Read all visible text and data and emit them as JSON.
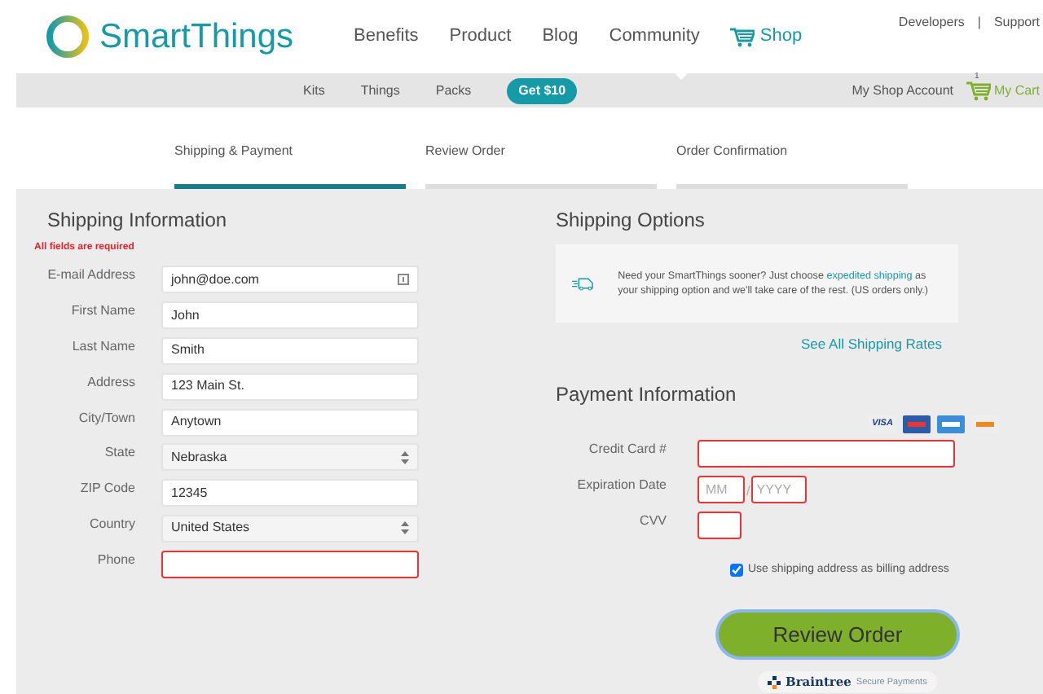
{
  "header": {
    "brand": "SmartThings",
    "nav": [
      {
        "label": "Benefits",
        "selected": false,
        "kind": "text"
      },
      {
        "label": "Product",
        "selected": false,
        "kind": "text"
      },
      {
        "label": "Blog",
        "selected": false,
        "kind": "text"
      },
      {
        "label": "Community",
        "selected": false,
        "kind": "text"
      },
      {
        "label": "Shop",
        "selected": true,
        "kind": "shop"
      }
    ],
    "utility_links": [
      "Developers",
      "|",
      "Support"
    ]
  },
  "subnav": {
    "items": [
      "Kits",
      "Things",
      "Packs"
    ],
    "promo": "Get $10",
    "account": "My Shop Account",
    "cart": {
      "label": "My Cart",
      "count": "1"
    }
  },
  "steps": [
    {
      "label": "Shipping & Payment",
      "selected": true
    },
    {
      "label": "Review Order",
      "selected": false
    },
    {
      "label": "Order Confirmation",
      "selected": false
    }
  ],
  "shipping_information": {
    "title": "Shipping Information",
    "required_note": "All fields are required",
    "fields": [
      {
        "label": "E-mail Address",
        "kind": "text",
        "value": "john@doe.com",
        "invalid": false,
        "autofill": true
      },
      {
        "label": "First Name",
        "kind": "text",
        "value": "John",
        "invalid": false
      },
      {
        "label": "Last Name",
        "kind": "text",
        "value": "Smith",
        "invalid": false
      },
      {
        "label": "Address",
        "kind": "text",
        "value": "123 Main St.",
        "invalid": false
      },
      {
        "label": "City/Town",
        "kind": "text",
        "value": "Anytown",
        "invalid": false
      },
      {
        "label": "State",
        "kind": "select",
        "value": "Nebraska",
        "invalid": false
      },
      {
        "label": "ZIP Code",
        "kind": "text",
        "value": "12345",
        "invalid": false
      },
      {
        "label": "Country",
        "kind": "select",
        "value": "United States",
        "invalid": false
      },
      {
        "label": "Phone",
        "kind": "text",
        "invalid": true
      }
    ]
  },
  "shipping_options": {
    "title": "Shipping Options",
    "notice": "Need your SmartThings sooner? Just choose ",
    "notice_link": "expedited shipping",
    "notice_end": " as your shipping option and we'll take care of the rest. (US orders only.)",
    "rates_link": "See All Shipping Rates"
  },
  "payment_information": {
    "title": "Payment Information",
    "card_brand": "VISA",
    "card_number": {
      "label": "Credit Card #",
      "invalid": true
    },
    "expiration": {
      "label": "Expiration Date",
      "month_placeholder": "MM",
      "separator": "/",
      "year_placeholder": "YYYY",
      "invalid": true
    },
    "cvv": {
      "label": "CVV",
      "invalid": true
    },
    "billing_same": {
      "label": "Use shipping address as billing address",
      "checked": true
    },
    "submit": "Review Order",
    "badge": {
      "brand": "Braintree",
      "tagline": "Secure Payments"
    }
  }
}
